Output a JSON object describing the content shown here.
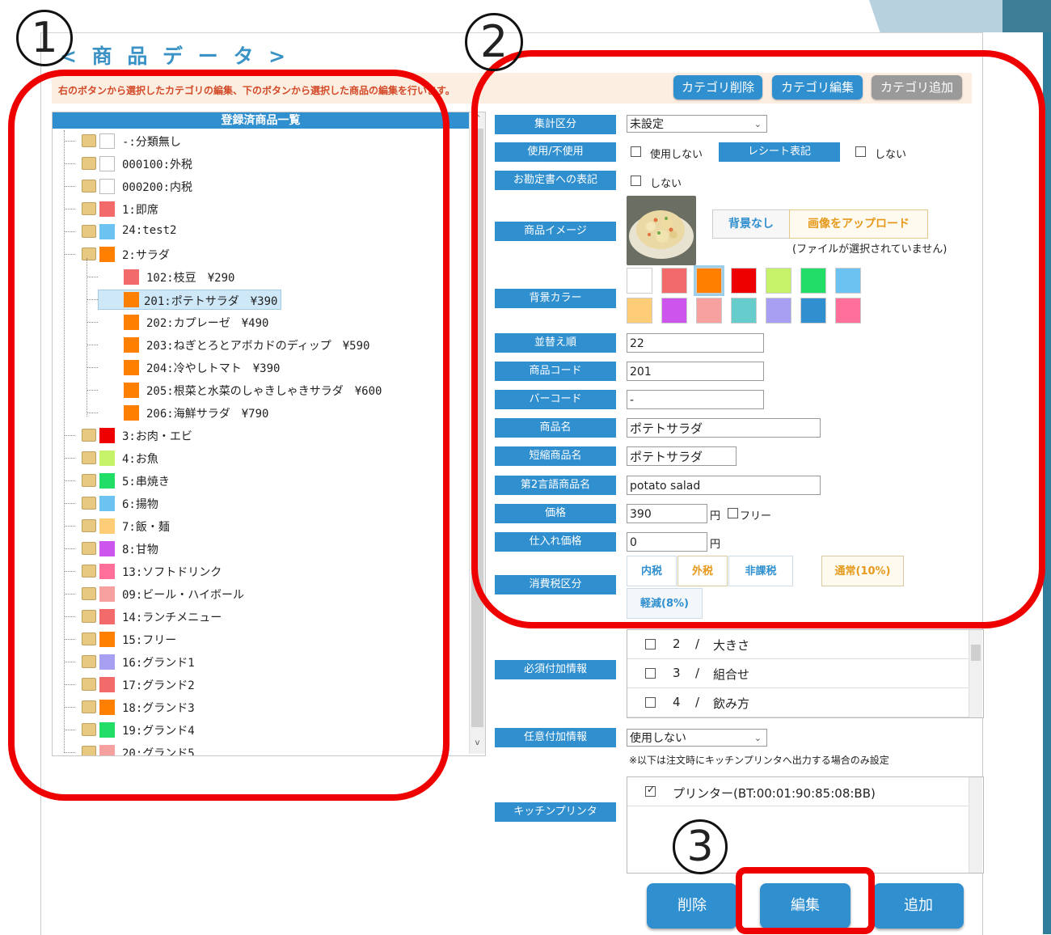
{
  "page": {
    "title": "< 商 品 デ ー タ >",
    "notice": "右のボタンから選択したカテゴリの編集、下のボタンから選択した商品の編集を行います。"
  },
  "category_buttons": {
    "delete": "カテゴリ削除",
    "edit": "カテゴリ編集",
    "add": "カテゴリ追加"
  },
  "tree": {
    "header": "登録済商品一覧",
    "scroll_up": "^",
    "scroll_down": "v",
    "rows": [
      {
        "label": "-:分類無し",
        "color": "#ffffff"
      },
      {
        "label": "000100:外税",
        "color": "#ffffff"
      },
      {
        "label": "000200:内税",
        "color": "#ffffff"
      },
      {
        "label": "1:即席",
        "color": "#f26a6a"
      },
      {
        "label": "24:test2",
        "color": "#6cc3f2"
      },
      {
        "label": "2:サラダ",
        "color": "#ff8000"
      },
      {
        "label": "102:枝豆　¥290",
        "color": "#f26a6a",
        "child": true
      },
      {
        "label": "201:ポテトサラダ　¥390",
        "color": "#ff8000",
        "child": true,
        "selected": true
      },
      {
        "label": "202:カプレーゼ　¥490",
        "color": "#ff8000",
        "child": true
      },
      {
        "label": "203:ねぎとろとアボカドのディップ　¥590",
        "color": "#ff8000",
        "child": true
      },
      {
        "label": "204:冷やしトマト　¥390",
        "color": "#ff8000",
        "child": true
      },
      {
        "label": "205:根菜と水菜のしゃきしゃきサラダ　¥600",
        "color": "#ff8000",
        "child": true
      },
      {
        "label": "206:海鮮サラダ　¥790",
        "color": "#ff8000",
        "child": true
      },
      {
        "label": "3:お肉・エビ",
        "color": "#ee0000"
      },
      {
        "label": "4:お魚",
        "color": "#c6f26a"
      },
      {
        "label": "5:串焼き",
        "color": "#22dd66"
      },
      {
        "label": "6:揚物",
        "color": "#6cc3f2"
      },
      {
        "label": "7:飯・麺",
        "color": "#ffcc77"
      },
      {
        "label": "8:甘物",
        "color": "#cc55ee"
      },
      {
        "label": "13:ソフトドリンク",
        "color": "#ff6f9a"
      },
      {
        "label": "09:ビール・ハイボール",
        "color": "#f7a0a0"
      },
      {
        "label": "14:ランチメニュー",
        "color": "#f26a6a"
      },
      {
        "label": "15:フリー",
        "color": "#ff8000"
      },
      {
        "label": "16:グランド1",
        "color": "#a7a0f2"
      },
      {
        "label": "17:グランド2",
        "color": "#f26a6a"
      },
      {
        "label": "18:グランド3",
        "color": "#ff8000"
      },
      {
        "label": "19:グランド4",
        "color": "#22dd66"
      },
      {
        "label": "20:グランド5",
        "color": "#f7a0a0"
      }
    ]
  },
  "form": {
    "aggregate": {
      "label": "集計区分",
      "value": "未設定"
    },
    "usage": {
      "label": "使用/不使用",
      "checkbox_text": "使用しない",
      "receipt_label": "レシート表記",
      "receipt_checkbox_text": "しない"
    },
    "invoice": {
      "label": "お勘定書への表記",
      "checkbox_text": "しない"
    },
    "image": {
      "label": "商品イメージ",
      "no_bg": "背景なし",
      "upload": "画像をアップロード",
      "file_status": "(ファイルが選択されていません)"
    },
    "bg_color": {
      "label": "背景カラー",
      "colors": [
        "#ffffff",
        "#f26a6a",
        "#ff8000",
        "#ee0000",
        "#c6f26a",
        "#22dd66",
        "#6cc3f2",
        "#ffcc77",
        "#cc55ee",
        "#f7a0a0",
        "#66cccc",
        "#a7a0f2",
        "#2f8fcf",
        "#ff6f9a"
      ],
      "selected_index": 2
    },
    "sort_order": {
      "label": "並替え順",
      "value": "22"
    },
    "code": {
      "label": "商品コード",
      "value": "201"
    },
    "barcode": {
      "label": "バーコード",
      "value": "-"
    },
    "name": {
      "label": "商品名",
      "value": "ポテトサラダ"
    },
    "short_name": {
      "label": "短縮商品名",
      "value": "ポテトサラダ"
    },
    "second_lang_name": {
      "label": "第2言語商品名",
      "value": "potato salad"
    },
    "price": {
      "label": "価格",
      "value": "390",
      "unit": "円",
      "free_text": "フリー"
    },
    "cost": {
      "label": "仕入れ価格",
      "value": "0",
      "unit": "円"
    },
    "tax": {
      "label": "消費税区分",
      "options": [
        "内税",
        "外税",
        "非課税"
      ],
      "rates": [
        "通常(10%)",
        "軽減(8%)"
      ]
    },
    "required_options": {
      "label": "必須付加情報",
      "items": [
        {
          "num": "2",
          "sep": "/",
          "name": "大きさ"
        },
        {
          "num": "3",
          "sep": "/",
          "name": "組合せ"
        },
        {
          "num": "4",
          "sep": "/",
          "name": "飲み方"
        }
      ]
    },
    "optional_info": {
      "label": "任意付加情報",
      "value": "使用しない",
      "note": "※以下は注文時にキッチンプリンタへ出力する場合のみ設定"
    },
    "kitchen_printer": {
      "label": "キッチンプリンタ",
      "printer": "プリンター(BT:00:01:90:85:08:BB)"
    }
  },
  "actions": {
    "delete": "削除",
    "edit": "編集",
    "add": "追加"
  },
  "annotations": {
    "one": "1",
    "two": "2",
    "three": "3"
  },
  "colors": {
    "accent": "#2f8fcf",
    "annotation_red": "#ee0000"
  }
}
